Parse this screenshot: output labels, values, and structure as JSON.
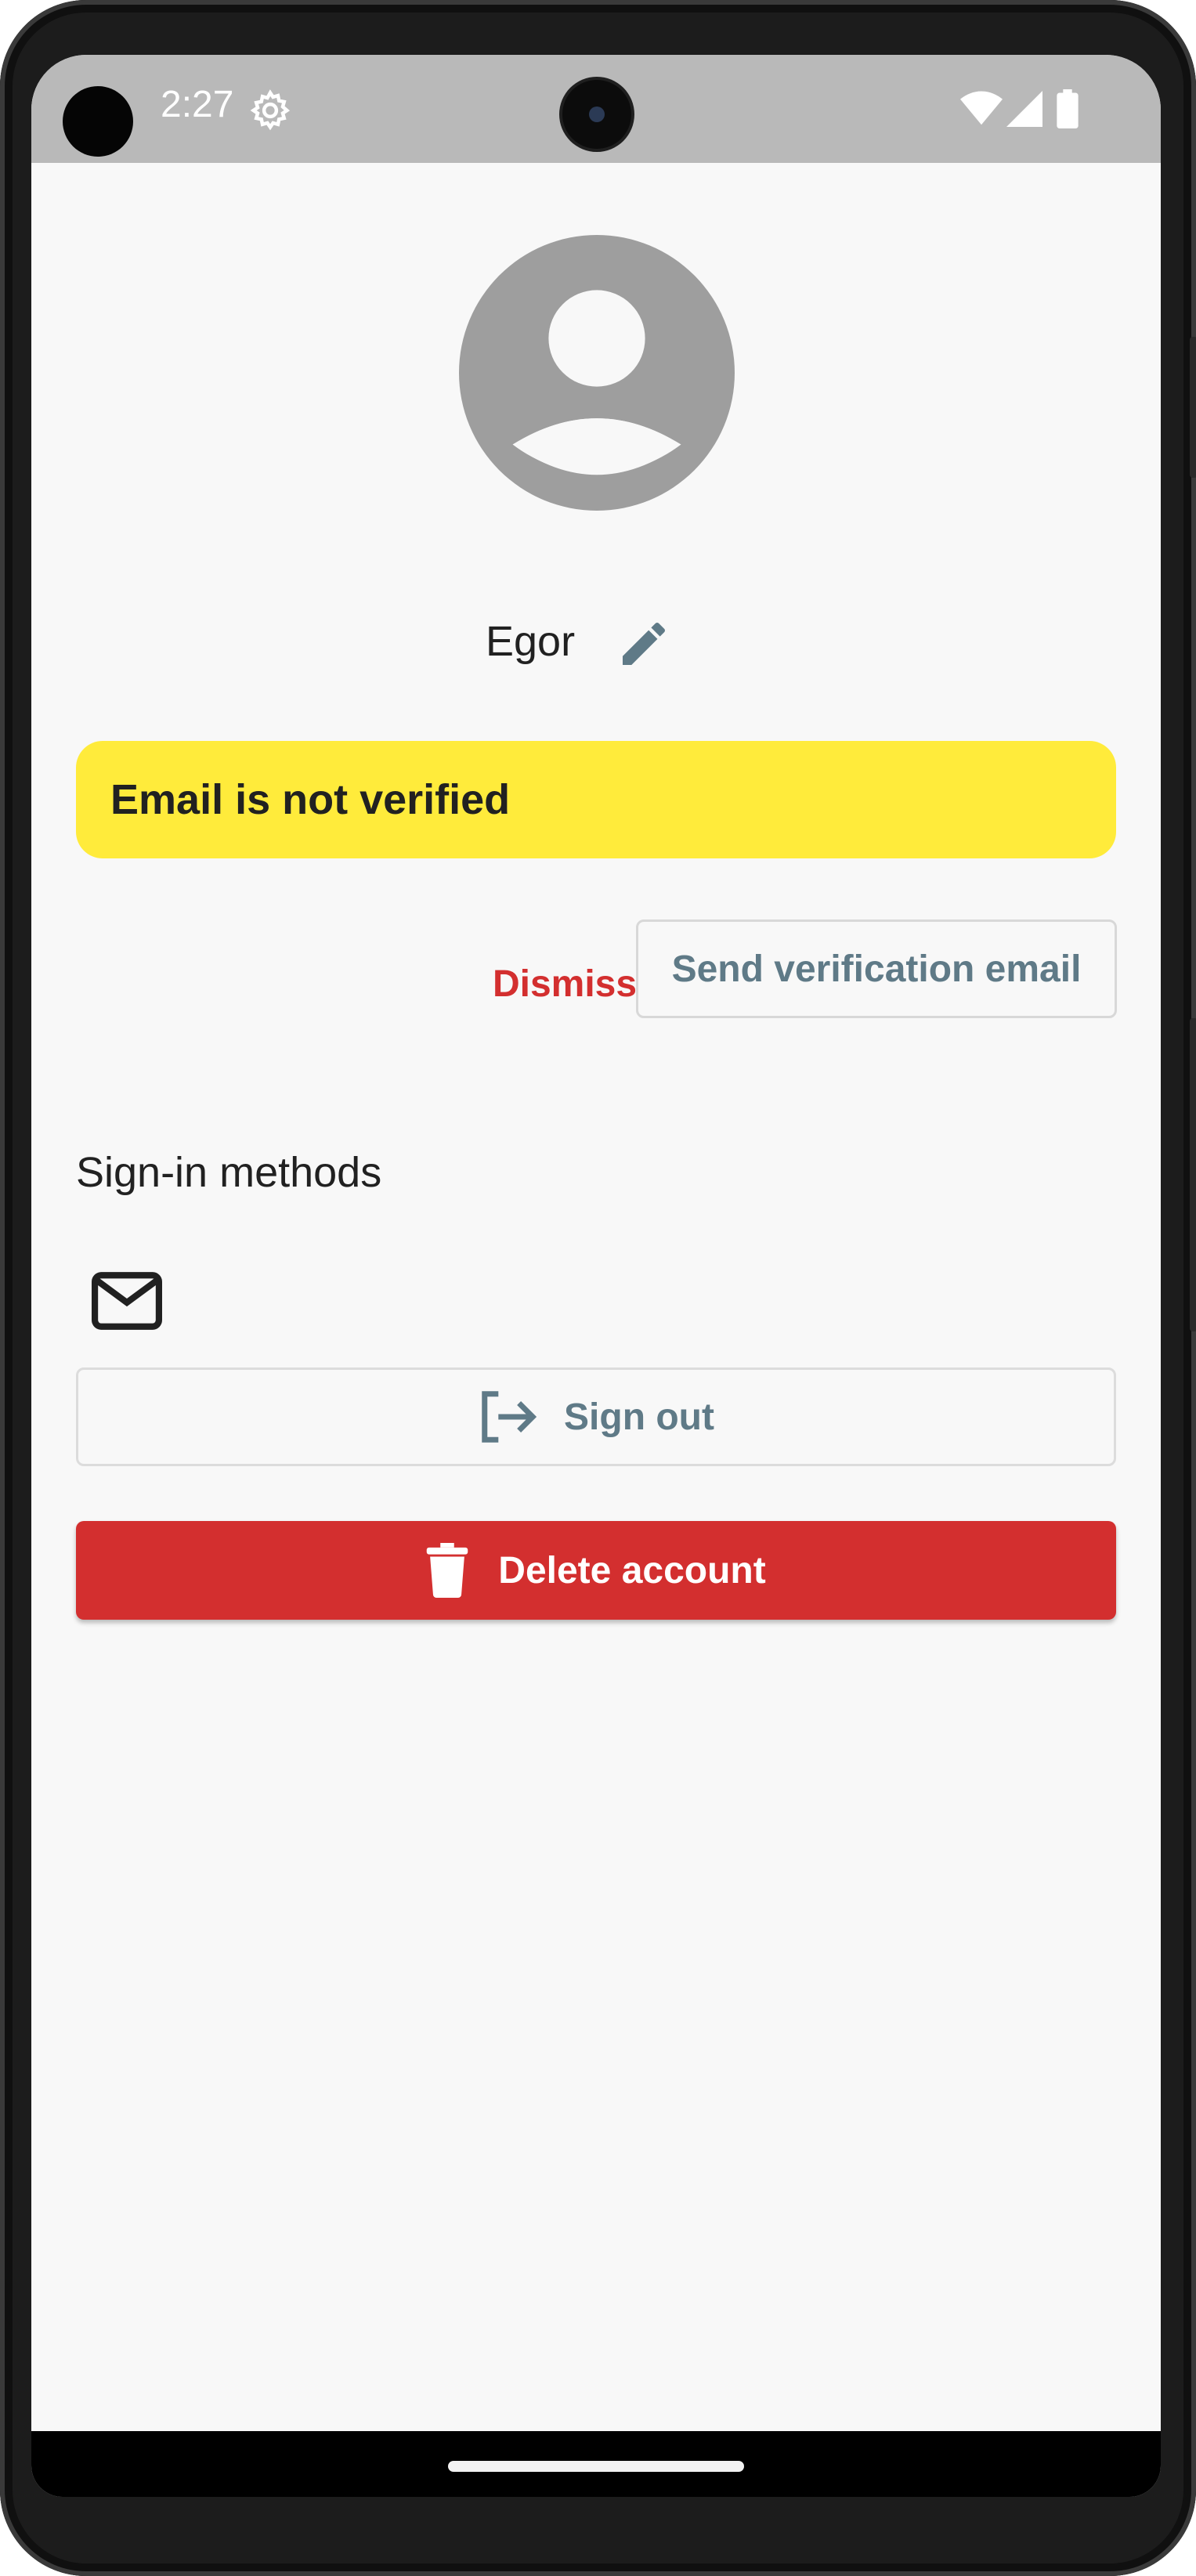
{
  "status_bar": {
    "time": "2:27",
    "icons": [
      "settings-gear-icon",
      "wifi-icon",
      "cellular-signal-icon",
      "battery-icon"
    ]
  },
  "profile": {
    "display_name": "Egor",
    "avatar_icon": "default-avatar-icon",
    "edit_icon": "pencil-icon"
  },
  "verification": {
    "banner_text": "Email is not verified",
    "banner_color": "#ffeb3b",
    "dismiss_label": "Dismiss",
    "send_label": "Send verification email"
  },
  "sign_in_methods": {
    "title": "Sign-in methods",
    "methods": [
      {
        "icon": "email-envelope-icon"
      }
    ]
  },
  "actions": {
    "sign_out_label": "Sign out",
    "sign_out_icon": "logout-icon",
    "delete_label": "Delete account",
    "delete_icon": "trash-icon",
    "danger_color": "#d32f2f",
    "accent_color": "#5f7a87"
  }
}
